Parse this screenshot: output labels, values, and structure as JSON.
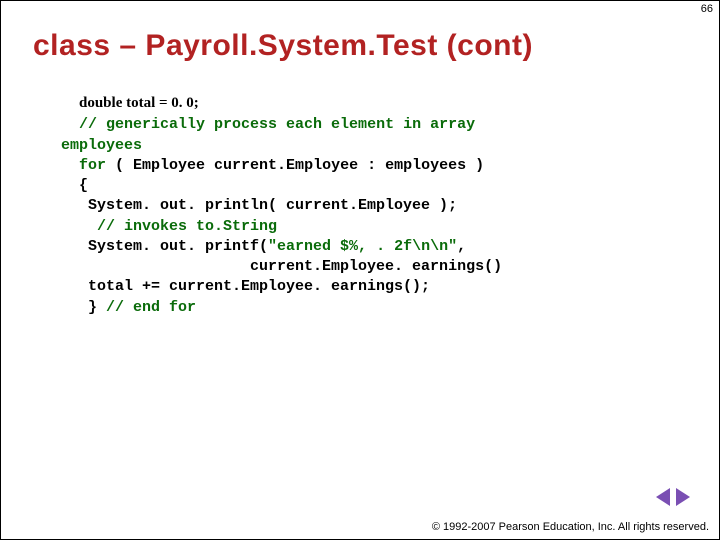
{
  "page_number": "66",
  "title": "class – Payroll.System.Test (cont)",
  "decl_line": "double total = 0. 0;",
  "code": {
    "l1a": "  ",
    "l1b": "// generically process each element in array",
    "l2": "employees",
    "l3a": "  ",
    "l3b": "for",
    "l3c": " ( Employee current.Employee : employees )",
    "l4": "  {",
    "l5": "   System. out. println( current.Employee );",
    "l6a": "    ",
    "l6b": "// invokes to.String",
    "l7": "",
    "l8a": "   System. out. printf(",
    "l8b": "\"earned $%, . 2f\\n\\n\"",
    "l8c": ",",
    "l9": "                     current.Employee. earnings()",
    "l10": "   total += current.Employee. earnings();",
    "l11a": "   } ",
    "l11b": "// end for"
  },
  "copyright": "© 1992-2007 Pearson Education, Inc.  All rights reserved."
}
